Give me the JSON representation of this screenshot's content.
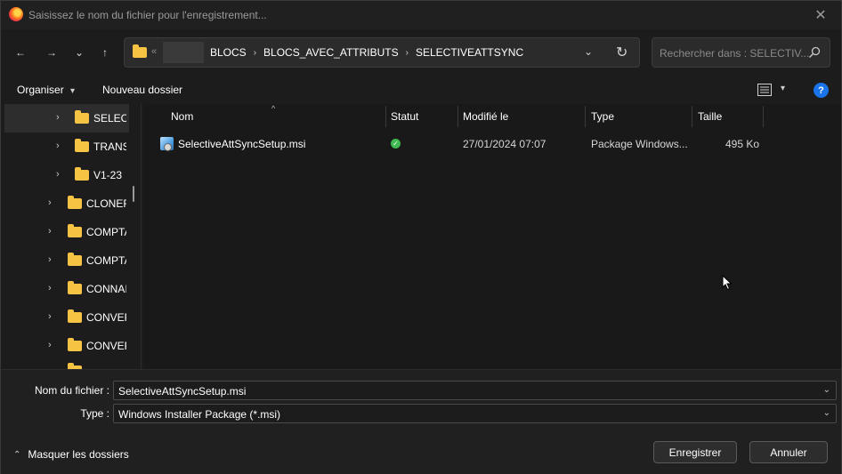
{
  "titlebar": {
    "title": "Saisissez le nom du fichier pour l'enregistrement...",
    "close": "✕"
  },
  "nav": {
    "back": "←",
    "forward": "→",
    "recent": "⌄",
    "up": "↑"
  },
  "address": {
    "overflow": "«",
    "crumbs": [
      "BLOCS",
      "BLOCS_AVEC_ATTRIBUTS",
      "SELECTIVEATTSYNC"
    ],
    "separator": "›",
    "dropdown": "⌄",
    "refresh": "↻"
  },
  "search": {
    "placeholder": "Rechercher dans : SELECTIV..."
  },
  "toolbar": {
    "organize": "Organiser",
    "organize_caret": "▾",
    "new_folder": "Nouveau dossier",
    "view_caret": "▾",
    "help": "?"
  },
  "sidebar": {
    "chevron": "›",
    "items": [
      {
        "label": "SELECTIVEATTSYNC",
        "selected": true
      },
      {
        "label": "TRANSFERT"
      },
      {
        "label": "V1-23"
      },
      {
        "label": "CLONER"
      },
      {
        "label": "COMPTAGE"
      },
      {
        "label": "COMPTAGE_BLOCS"
      },
      {
        "label": "CONNAISSANCE"
      },
      {
        "label": "CONVERSION"
      },
      {
        "label": "CONVERTIR"
      }
    ]
  },
  "columns": {
    "name": "Nom",
    "status": "Statut",
    "modified": "Modifié le",
    "type": "Type",
    "size": "Taille",
    "sort_arrow": "^"
  },
  "files": [
    {
      "name": "SelectiveAttSyncSetup.msi",
      "status_glyph": "✓",
      "modified": "27/01/2024 07:07",
      "type": "Package Windows...",
      "size": "495 Ko"
    }
  ],
  "footer": {
    "filename_label": "Nom du fichier :",
    "filename_value": "SelectiveAttSyncSetup.msi",
    "type_label": "Type :",
    "type_value": "Windows Installer Package (*.msi)",
    "dropdown": "⌄",
    "hide_folders_caret": "⌃",
    "hide_folders": "Masquer les dossiers",
    "save": "Enregistrer",
    "cancel": "Annuler"
  },
  "colors": {
    "accent": "#1a73e8",
    "folder": "#f6c343",
    "status_ok": "#3fb950",
    "background": "#1c1c1c"
  }
}
